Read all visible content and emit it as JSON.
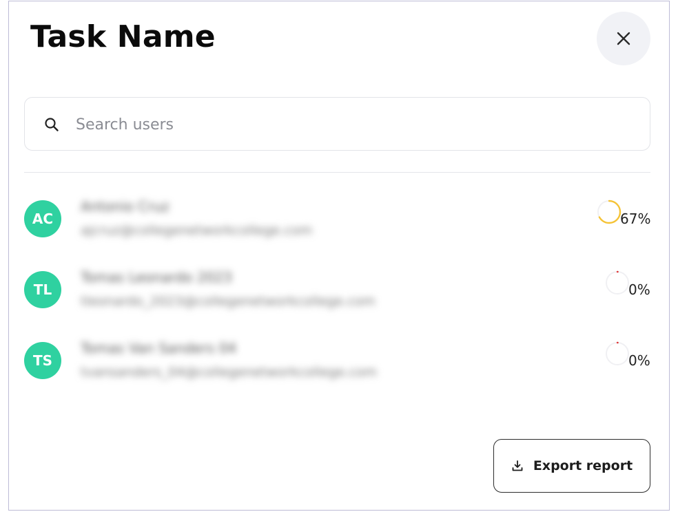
{
  "dialog": {
    "title": "Task Name",
    "close_icon": "close-icon"
  },
  "search": {
    "icon": "search-icon",
    "placeholder": "Search users",
    "value": ""
  },
  "users": [
    {
      "initials": "AC",
      "name": "Antonio Cruz",
      "email": "ajcruz@collegenetworkcollege.com",
      "progress_percent": 67,
      "progress_label": "67%",
      "progress_color": "#f5c336"
    },
    {
      "initials": "TL",
      "name": "Tomas Leonardo 2023",
      "email": "tleonardo_2023@collegenetworkcollege.com",
      "progress_percent": 0,
      "progress_label": "0%",
      "progress_color": "#e03a3a"
    },
    {
      "initials": "TS",
      "name": "Tomas Van Sanders 04",
      "email": "tvansanders_04@collegenetworkcollege.com",
      "progress_percent": 0,
      "progress_label": "0%",
      "progress_color": "#e03a3a"
    }
  ],
  "export": {
    "icon": "download-icon",
    "label": "Export report"
  },
  "colors": {
    "avatar_bg": "#2fd1a0",
    "close_bg": "#f1f2f6",
    "border": "#bdbbd6"
  }
}
